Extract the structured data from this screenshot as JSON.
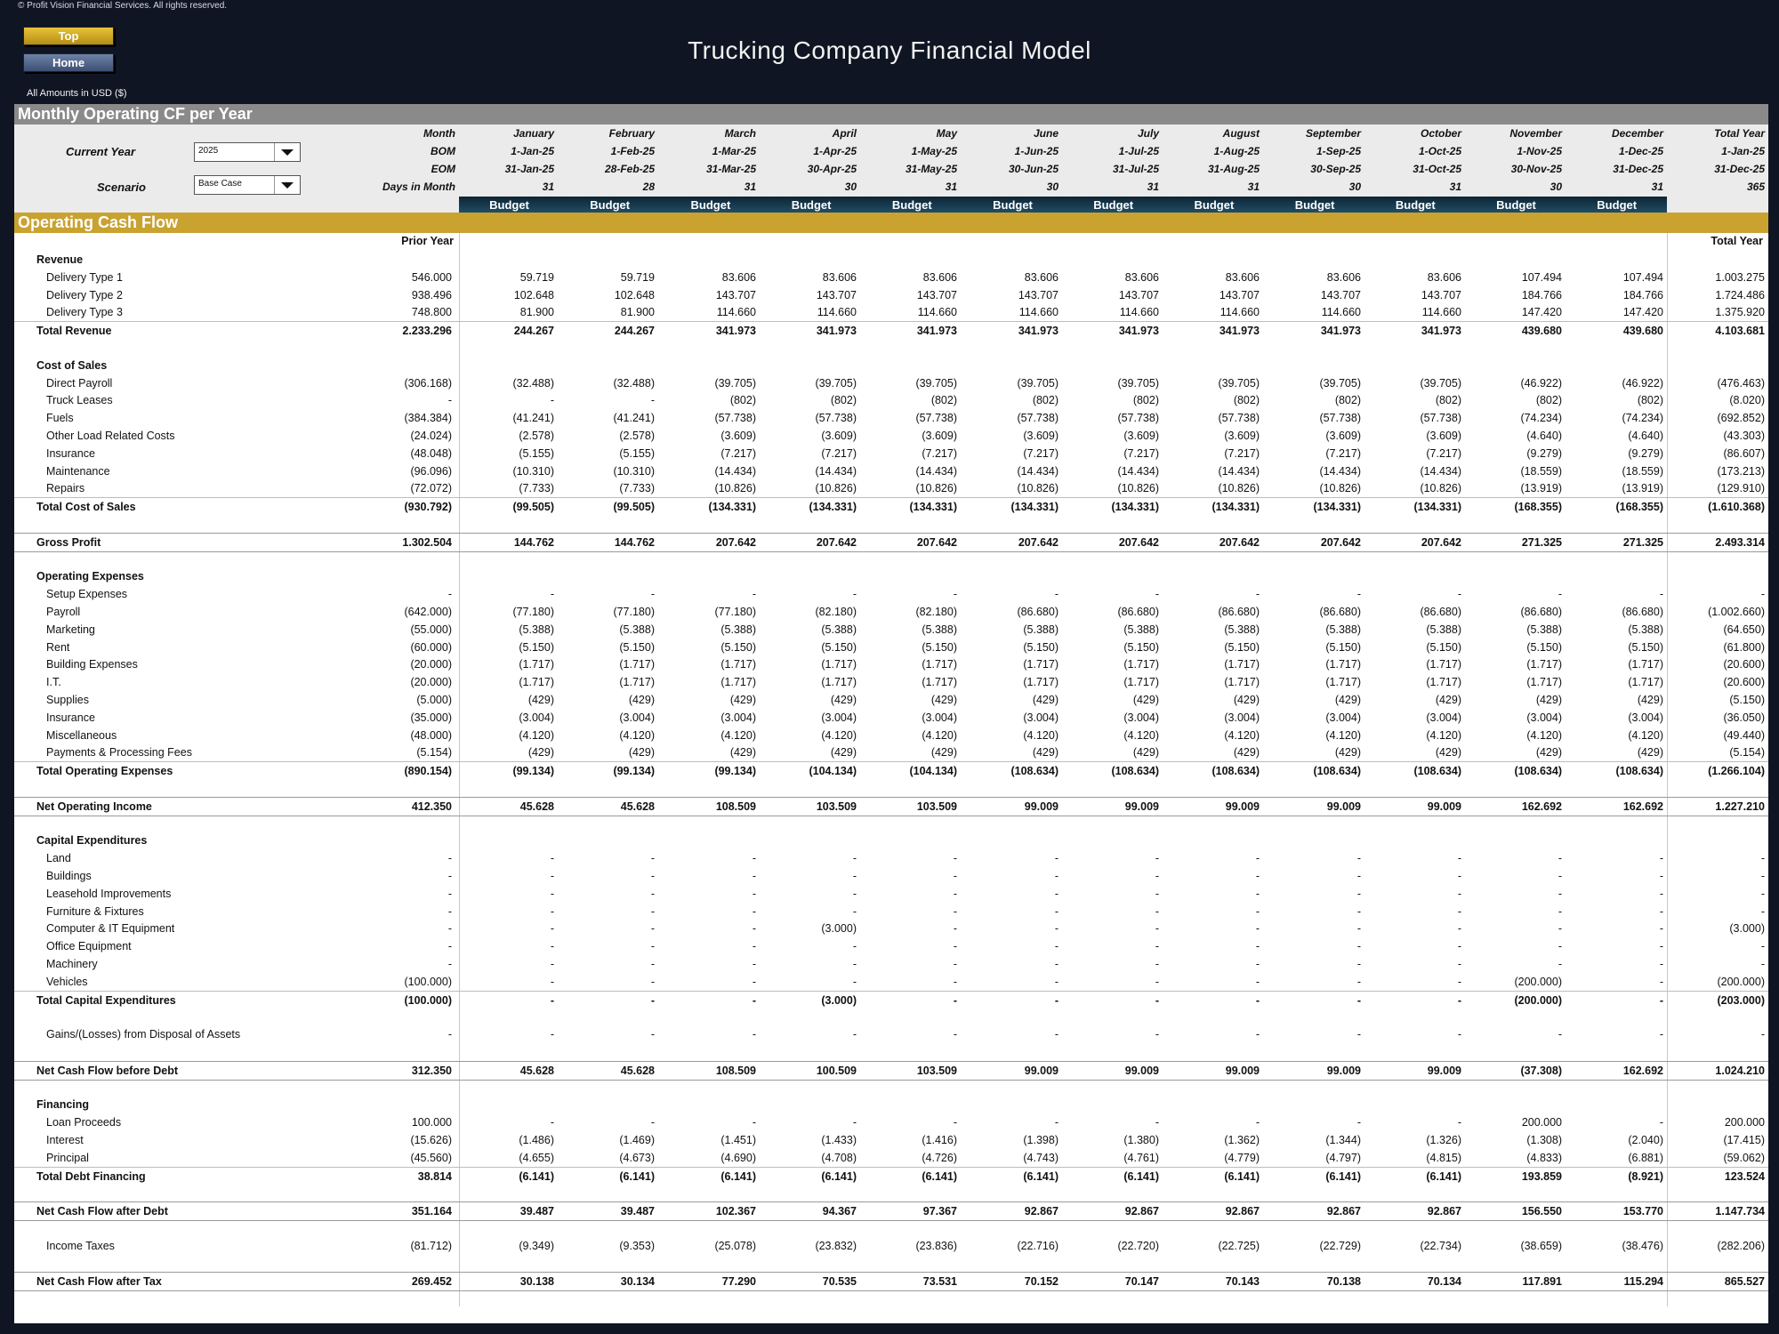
{
  "copyright": "© Profit Vision Financial Services. All rights reserved.",
  "nav": {
    "top": "Top",
    "home": "Home"
  },
  "title": "Trucking Company Financial Model",
  "amounts_label": "All Amounts in  USD ($)",
  "section_title": "Monthly Operating CF per Year",
  "params": {
    "current_year_label": "Current Year",
    "current_year": "2025",
    "scenario_label": "Scenario",
    "scenario": "Base Case"
  },
  "header_labels": {
    "month": "Month",
    "bom": "BOM",
    "eom": "EOM",
    "days": "Days in Month"
  },
  "months": [
    "January",
    "February",
    "March",
    "April",
    "May",
    "June",
    "July",
    "August",
    "September",
    "October",
    "November",
    "December",
    "Total Year"
  ],
  "bom": [
    "1-Jan-25",
    "1-Feb-25",
    "1-Mar-25",
    "1-Apr-25",
    "1-May-25",
    "1-Jun-25",
    "1-Jul-25",
    "1-Aug-25",
    "1-Sep-25",
    "1-Oct-25",
    "1-Nov-25",
    "1-Dec-25",
    "1-Jan-25"
  ],
  "eom": [
    "31-Jan-25",
    "28-Feb-25",
    "31-Mar-25",
    "30-Apr-25",
    "31-May-25",
    "30-Jun-25",
    "31-Jul-25",
    "31-Aug-25",
    "30-Sep-25",
    "31-Oct-25",
    "30-Nov-25",
    "31-Dec-25",
    "31-Dec-25"
  ],
  "days": [
    "31",
    "28",
    "31",
    "30",
    "31",
    "30",
    "31",
    "31",
    "30",
    "31",
    "30",
    "31",
    "365"
  ],
  "budget_label": "Budget",
  "cf_section_title": "Operating Cash Flow",
  "prior_year_label": "Prior Year",
  "total_year_label": "Total Year",
  "rows": [
    {
      "label": "Revenue",
      "type": "head"
    },
    {
      "label": "Delivery Type 1",
      "type": "item",
      "values": [
        "546.000",
        "59.719",
        "59.719",
        "83.606",
        "83.606",
        "83.606",
        "83.606",
        "83.606",
        "83.606",
        "83.606",
        "83.606",
        "107.494",
        "107.494",
        "1.003.275"
      ]
    },
    {
      "label": "Delivery Type 2",
      "type": "item",
      "values": [
        "938.496",
        "102.648",
        "102.648",
        "143.707",
        "143.707",
        "143.707",
        "143.707",
        "143.707",
        "143.707",
        "143.707",
        "143.707",
        "184.766",
        "184.766",
        "1.724.486"
      ]
    },
    {
      "label": "Delivery Type 3",
      "type": "item",
      "values": [
        "748.800",
        "81.900",
        "81.900",
        "114.660",
        "114.660",
        "114.660",
        "114.660",
        "114.660",
        "114.660",
        "114.660",
        "114.660",
        "147.420",
        "147.420",
        "1.375.920"
      ]
    },
    {
      "label": "Total Revenue",
      "type": "total",
      "values": [
        "2.233.296",
        "244.267",
        "244.267",
        "341.973",
        "341.973",
        "341.973",
        "341.973",
        "341.973",
        "341.973",
        "341.973",
        "341.973",
        "439.680",
        "439.680",
        "4.103.681"
      ]
    },
    {
      "type": "blank"
    },
    {
      "label": "Cost of Sales",
      "type": "head"
    },
    {
      "label": "Direct Payroll",
      "type": "item",
      "values": [
        "(306.168)",
        "(32.488)",
        "(32.488)",
        "(39.705)",
        "(39.705)",
        "(39.705)",
        "(39.705)",
        "(39.705)",
        "(39.705)",
        "(39.705)",
        "(39.705)",
        "(46.922)",
        "(46.922)",
        "(476.463)"
      ]
    },
    {
      "label": "Truck Leases",
      "type": "item",
      "values": [
        "-",
        "-",
        "-",
        "(802)",
        "(802)",
        "(802)",
        "(802)",
        "(802)",
        "(802)",
        "(802)",
        "(802)",
        "(802)",
        "(802)",
        "(8.020)"
      ]
    },
    {
      "label": "Fuels",
      "type": "item",
      "values": [
        "(384.384)",
        "(41.241)",
        "(41.241)",
        "(57.738)",
        "(57.738)",
        "(57.738)",
        "(57.738)",
        "(57.738)",
        "(57.738)",
        "(57.738)",
        "(57.738)",
        "(74.234)",
        "(74.234)",
        "(692.852)"
      ]
    },
    {
      "label": "Other Load Related Costs",
      "type": "item",
      "values": [
        "(24.024)",
        "(2.578)",
        "(2.578)",
        "(3.609)",
        "(3.609)",
        "(3.609)",
        "(3.609)",
        "(3.609)",
        "(3.609)",
        "(3.609)",
        "(3.609)",
        "(4.640)",
        "(4.640)",
        "(43.303)"
      ]
    },
    {
      "label": "Insurance",
      "type": "item",
      "values": [
        "(48.048)",
        "(5.155)",
        "(5.155)",
        "(7.217)",
        "(7.217)",
        "(7.217)",
        "(7.217)",
        "(7.217)",
        "(7.217)",
        "(7.217)",
        "(7.217)",
        "(9.279)",
        "(9.279)",
        "(86.607)"
      ]
    },
    {
      "label": "Maintenance",
      "type": "item",
      "values": [
        "(96.096)",
        "(10.310)",
        "(10.310)",
        "(14.434)",
        "(14.434)",
        "(14.434)",
        "(14.434)",
        "(14.434)",
        "(14.434)",
        "(14.434)",
        "(14.434)",
        "(18.559)",
        "(18.559)",
        "(173.213)"
      ]
    },
    {
      "label": "Repairs",
      "type": "item",
      "values": [
        "(72.072)",
        "(7.733)",
        "(7.733)",
        "(10.826)",
        "(10.826)",
        "(10.826)",
        "(10.826)",
        "(10.826)",
        "(10.826)",
        "(10.826)",
        "(10.826)",
        "(13.919)",
        "(13.919)",
        "(129.910)"
      ]
    },
    {
      "label": "Total Cost of Sales",
      "type": "total",
      "values": [
        "(930.792)",
        "(99.505)",
        "(99.505)",
        "(134.331)",
        "(134.331)",
        "(134.331)",
        "(134.331)",
        "(134.331)",
        "(134.331)",
        "(134.331)",
        "(134.331)",
        "(168.355)",
        "(168.355)",
        "(1.610.368)"
      ]
    },
    {
      "type": "blank"
    },
    {
      "label": "Gross Profit",
      "type": "major",
      "values": [
        "1.302.504",
        "144.762",
        "144.762",
        "207.642",
        "207.642",
        "207.642",
        "207.642",
        "207.642",
        "207.642",
        "207.642",
        "207.642",
        "271.325",
        "271.325",
        "2.493.314"
      ]
    },
    {
      "type": "blank"
    },
    {
      "label": "Operating Expenses",
      "type": "head"
    },
    {
      "label": "Setup Expenses",
      "type": "item",
      "values": [
        "-",
        "-",
        "-",
        "-",
        "-",
        "-",
        "-",
        "-",
        "-",
        "-",
        "-",
        "-",
        "-",
        "-"
      ]
    },
    {
      "label": "Payroll",
      "type": "item",
      "values": [
        "(642.000)",
        "(77.180)",
        "(77.180)",
        "(77.180)",
        "(82.180)",
        "(82.180)",
        "(86.680)",
        "(86.680)",
        "(86.680)",
        "(86.680)",
        "(86.680)",
        "(86.680)",
        "(86.680)",
        "(1.002.660)"
      ]
    },
    {
      "label": "Marketing",
      "type": "item",
      "values": [
        "(55.000)",
        "(5.388)",
        "(5.388)",
        "(5.388)",
        "(5.388)",
        "(5.388)",
        "(5.388)",
        "(5.388)",
        "(5.388)",
        "(5.388)",
        "(5.388)",
        "(5.388)",
        "(5.388)",
        "(64.650)"
      ]
    },
    {
      "label": "Rent",
      "type": "item",
      "values": [
        "(60.000)",
        "(5.150)",
        "(5.150)",
        "(5.150)",
        "(5.150)",
        "(5.150)",
        "(5.150)",
        "(5.150)",
        "(5.150)",
        "(5.150)",
        "(5.150)",
        "(5.150)",
        "(5.150)",
        "(61.800)"
      ]
    },
    {
      "label": "Building Expenses",
      "type": "item",
      "values": [
        "(20.000)",
        "(1.717)",
        "(1.717)",
        "(1.717)",
        "(1.717)",
        "(1.717)",
        "(1.717)",
        "(1.717)",
        "(1.717)",
        "(1.717)",
        "(1.717)",
        "(1.717)",
        "(1.717)",
        "(20.600)"
      ]
    },
    {
      "label": "I.T.",
      "type": "item",
      "values": [
        "(20.000)",
        "(1.717)",
        "(1.717)",
        "(1.717)",
        "(1.717)",
        "(1.717)",
        "(1.717)",
        "(1.717)",
        "(1.717)",
        "(1.717)",
        "(1.717)",
        "(1.717)",
        "(1.717)",
        "(20.600)"
      ]
    },
    {
      "label": "Supplies",
      "type": "item",
      "values": [
        "(5.000)",
        "(429)",
        "(429)",
        "(429)",
        "(429)",
        "(429)",
        "(429)",
        "(429)",
        "(429)",
        "(429)",
        "(429)",
        "(429)",
        "(429)",
        "(5.150)"
      ]
    },
    {
      "label": "Insurance",
      "type": "item",
      "values": [
        "(35.000)",
        "(3.004)",
        "(3.004)",
        "(3.004)",
        "(3.004)",
        "(3.004)",
        "(3.004)",
        "(3.004)",
        "(3.004)",
        "(3.004)",
        "(3.004)",
        "(3.004)",
        "(3.004)",
        "(36.050)"
      ]
    },
    {
      "label": "Miscellaneous",
      "type": "item",
      "values": [
        "(48.000)",
        "(4.120)",
        "(4.120)",
        "(4.120)",
        "(4.120)",
        "(4.120)",
        "(4.120)",
        "(4.120)",
        "(4.120)",
        "(4.120)",
        "(4.120)",
        "(4.120)",
        "(4.120)",
        "(49.440)"
      ]
    },
    {
      "label": "Payments & Processing Fees",
      "type": "item",
      "values": [
        "(5.154)",
        "(429)",
        "(429)",
        "(429)",
        "(429)",
        "(429)",
        "(429)",
        "(429)",
        "(429)",
        "(429)",
        "(429)",
        "(429)",
        "(429)",
        "(5.154)"
      ]
    },
    {
      "label": "Total Operating Expenses",
      "type": "total",
      "values": [
        "(890.154)",
        "(99.134)",
        "(99.134)",
        "(99.134)",
        "(104.134)",
        "(104.134)",
        "(108.634)",
        "(108.634)",
        "(108.634)",
        "(108.634)",
        "(108.634)",
        "(108.634)",
        "(108.634)",
        "(1.266.104)"
      ]
    },
    {
      "type": "blank"
    },
    {
      "label": "Net Operating Income",
      "type": "major",
      "values": [
        "412.350",
        "45.628",
        "45.628",
        "108.509",
        "103.509",
        "103.509",
        "99.009",
        "99.009",
        "99.009",
        "99.009",
        "99.009",
        "162.692",
        "162.692",
        "1.227.210"
      ]
    },
    {
      "type": "blank"
    },
    {
      "label": "Capital Expenditures",
      "type": "head"
    },
    {
      "label": "Land",
      "type": "item",
      "values": [
        "-",
        "-",
        "-",
        "-",
        "-",
        "-",
        "-",
        "-",
        "-",
        "-",
        "-",
        "-",
        "-",
        "-"
      ]
    },
    {
      "label": "Buildings",
      "type": "item",
      "values": [
        "-",
        "-",
        "-",
        "-",
        "-",
        "-",
        "-",
        "-",
        "-",
        "-",
        "-",
        "-",
        "-",
        "-"
      ]
    },
    {
      "label": "Leasehold Improvements",
      "type": "item",
      "values": [
        "-",
        "-",
        "-",
        "-",
        "-",
        "-",
        "-",
        "-",
        "-",
        "-",
        "-",
        "-",
        "-",
        "-"
      ]
    },
    {
      "label": "Furniture & Fixtures",
      "type": "item",
      "values": [
        "-",
        "-",
        "-",
        "-",
        "-",
        "-",
        "-",
        "-",
        "-",
        "-",
        "-",
        "-",
        "-",
        "-"
      ]
    },
    {
      "label": "Computer & IT Equipment",
      "type": "item",
      "values": [
        "-",
        "-",
        "-",
        "-",
        "(3.000)",
        "-",
        "-",
        "-",
        "-",
        "-",
        "-",
        "-",
        "-",
        "(3.000)"
      ]
    },
    {
      "label": "Office Equipment",
      "type": "item",
      "values": [
        "-",
        "-",
        "-",
        "-",
        "-",
        "-",
        "-",
        "-",
        "-",
        "-",
        "-",
        "-",
        "-",
        "-"
      ]
    },
    {
      "label": "Machinery",
      "type": "item",
      "values": [
        "-",
        "-",
        "-",
        "-",
        "-",
        "-",
        "-",
        "-",
        "-",
        "-",
        "-",
        "-",
        "-",
        "-"
      ]
    },
    {
      "label": "Vehicles",
      "type": "item",
      "values": [
        "(100.000)",
        "-",
        "-",
        "-",
        "-",
        "-",
        "-",
        "-",
        "-",
        "-",
        "-",
        "(200.000)",
        "-",
        "(200.000)"
      ]
    },
    {
      "label": "Total Capital Expenditures",
      "type": "total",
      "values": [
        "(100.000)",
        "-",
        "-",
        "-",
        "(3.000)",
        "-",
        "-",
        "-",
        "-",
        "-",
        "-",
        "(200.000)",
        "-",
        "(203.000)"
      ]
    },
    {
      "type": "blank"
    },
    {
      "label": "Gains/(Losses) from Disposal of Assets",
      "type": "item",
      "values": [
        "-",
        "-",
        "-",
        "-",
        "-",
        "-",
        "-",
        "-",
        "-",
        "-",
        "-",
        "-",
        "-",
        "-"
      ]
    },
    {
      "type": "blank"
    },
    {
      "label": "Net Cash Flow before Debt",
      "type": "major",
      "values": [
        "312.350",
        "45.628",
        "45.628",
        "108.509",
        "100.509",
        "103.509",
        "99.009",
        "99.009",
        "99.009",
        "99.009",
        "99.009",
        "(37.308)",
        "162.692",
        "1.024.210"
      ]
    },
    {
      "type": "blank"
    },
    {
      "label": "Financing",
      "type": "head"
    },
    {
      "label": "Loan Proceeds",
      "type": "item",
      "values": [
        "100.000",
        "-",
        "-",
        "-",
        "-",
        "-",
        "-",
        "-",
        "-",
        "-",
        "-",
        "200.000",
        "-",
        "200.000"
      ]
    },
    {
      "label": "Interest",
      "type": "item",
      "values": [
        "(15.626)",
        "(1.486)",
        "(1.469)",
        "(1.451)",
        "(1.433)",
        "(1.416)",
        "(1.398)",
        "(1.380)",
        "(1.362)",
        "(1.344)",
        "(1.326)",
        "(1.308)",
        "(2.040)",
        "(17.415)"
      ]
    },
    {
      "label": "Principal",
      "type": "item",
      "values": [
        "(45.560)",
        "(4.655)",
        "(4.673)",
        "(4.690)",
        "(4.708)",
        "(4.726)",
        "(4.743)",
        "(4.761)",
        "(4.779)",
        "(4.797)",
        "(4.815)",
        "(4.833)",
        "(6.881)",
        "(59.062)"
      ]
    },
    {
      "label": "Total Debt Financing",
      "type": "total",
      "values": [
        "38.814",
        "(6.141)",
        "(6.141)",
        "(6.141)",
        "(6.141)",
        "(6.141)",
        "(6.141)",
        "(6.141)",
        "(6.141)",
        "(6.141)",
        "(6.141)",
        "193.859",
        "(8.921)",
        "123.524"
      ]
    },
    {
      "type": "blank"
    },
    {
      "label": "Net Cash Flow after Debt",
      "type": "major",
      "values": [
        "351.164",
        "39.487",
        "39.487",
        "102.367",
        "94.367",
        "97.367",
        "92.867",
        "92.867",
        "92.867",
        "92.867",
        "92.867",
        "156.550",
        "153.770",
        "1.147.734"
      ]
    },
    {
      "type": "blank"
    },
    {
      "label": "Income Taxes",
      "type": "item",
      "values": [
        "(81.712)",
        "(9.349)",
        "(9.353)",
        "(25.078)",
        "(23.832)",
        "(23.836)",
        "(22.716)",
        "(22.720)",
        "(22.725)",
        "(22.729)",
        "(22.734)",
        "(38.659)",
        "(38.476)",
        "(282.206)"
      ]
    },
    {
      "type": "blank"
    },
    {
      "label": "Net Cash Flow after Tax",
      "type": "major",
      "values": [
        "269.452",
        "30.138",
        "30.134",
        "77.290",
        "70.535",
        "73.531",
        "70.152",
        "70.147",
        "70.143",
        "70.138",
        "70.134",
        "117.891",
        "115.294",
        "865.527"
      ]
    }
  ]
}
